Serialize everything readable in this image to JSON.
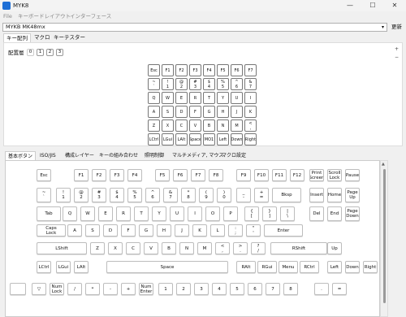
{
  "window": {
    "title": "MYK8",
    "minimize": "—",
    "maximize": "☐",
    "close": "✕"
  },
  "menu": [
    "File",
    "キーボードレイアウト",
    "インターフェース"
  ],
  "keyboard_select": {
    "value": "MYKB MK48mx",
    "arrow": "▾"
  },
  "update_button": "更新",
  "tabs": [
    "キー配列",
    "マクロ",
    "キーテスター"
  ],
  "layer": {
    "label": "配置層",
    "buttons": [
      "0",
      "1",
      "2",
      "3"
    ]
  },
  "zoom": {
    "in": "+",
    "out": "−"
  },
  "mini_keys": [
    "Esc",
    "F1",
    "F2",
    "F3",
    "F4",
    "F5",
    "F6",
    "F7",
    "~\n`",
    "!\n1",
    "@\n2",
    "#\n3",
    "$\n4",
    "%\n5",
    "^\n6",
    "&\n7",
    "Q",
    "W",
    "E",
    "R",
    "T",
    "Y",
    "U",
    "I",
    "A",
    "S",
    "D",
    "F",
    "G",
    "H",
    "J",
    "K",
    "Z",
    "X",
    "C",
    "V",
    "B",
    "N",
    "M",
    "<\n,",
    "LCtrl",
    "LGui",
    "LAlt",
    "Space",
    "MO1",
    "Left",
    "Down",
    "Right"
  ],
  "category_tabs": [
    "基本ボタン",
    "ISO/JIS",
    "構成レイヤー",
    "キーの組み合わせ",
    "照明制御",
    "マルチメディア, マウス",
    "マクロ設定"
  ],
  "key_rows": [
    [
      "Esc",
      "F1",
      "F2",
      "F3",
      "F4",
      "F5",
      "F6",
      "F7",
      "F8",
      "F9",
      "F10",
      "F11",
      "F12",
      "Print\nScreen",
      "Scroll\nLock",
      "Pause"
    ],
    [
      "~\n`",
      "!\n1",
      "@\n2",
      "#\n3",
      "$\n4",
      "%\n5",
      "^\n6",
      "&\n7",
      "*\n8",
      "(\n9",
      ")\n0",
      "_\n-",
      "+\n=",
      "Bksp",
      "Insert",
      "Home",
      "Page\nUp"
    ],
    [
      "Tab",
      "Q",
      "W",
      "E",
      "R",
      "T",
      "Y",
      "U",
      "I",
      "O",
      "P",
      "{\n[",
      "}\n]",
      "|\n\\",
      "Del",
      "End",
      "Page\nDown"
    ],
    [
      "Caps\nLock",
      "A",
      "S",
      "D",
      "F",
      "G",
      "H",
      "J",
      "K",
      "L",
      ":\n;",
      "\"\n'",
      "Enter"
    ],
    [
      "LShift",
      "Z",
      "X",
      "C",
      "V",
      "B",
      "N",
      "M",
      "<\n,",
      ">\n.",
      "?\n/",
      "RShift",
      "Up"
    ],
    [
      "LCtrl",
      "LGui",
      "LAlt",
      "Space",
      "RAlt",
      "RGui",
      "Menu",
      "RCtrl",
      "Left",
      "Down",
      "Right"
    ],
    [
      "",
      "▽",
      "Num\nLock",
      "/",
      "*",
      "-",
      "+",
      "Num\nEnter",
      "1",
      "2",
      "3",
      "4",
      "5",
      "6",
      "7",
      "8",
      ".",
      "="
    ]
  ]
}
